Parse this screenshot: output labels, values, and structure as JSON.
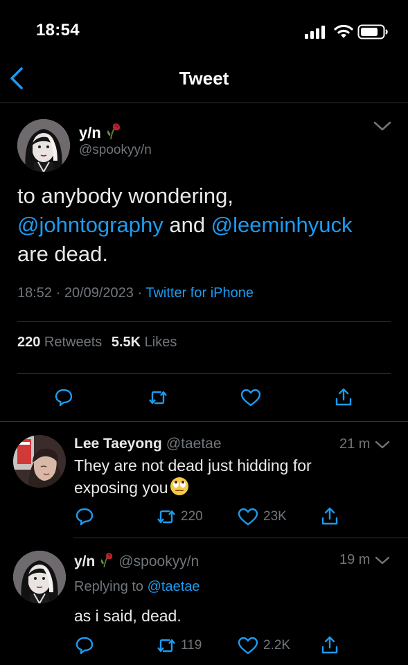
{
  "status_bar": {
    "time": "18:54"
  },
  "nav": {
    "title": "Tweet"
  },
  "tweet": {
    "display_name": "y/n",
    "handle": "@spookyy/n",
    "text_line1": "to anybody wondering,",
    "mention1": "@johntography",
    "and_word": " and ",
    "mention2": "@leeminhyuck",
    "text_line3": "are dead.",
    "timestamp": "18:52 · 20/09/2023 · ",
    "source": "Twitter for iPhone",
    "retweets_count": "220",
    "retweets_label": " Retweets",
    "likes_count": "5.5K",
    "likes_label": " Likes"
  },
  "replies": [
    {
      "display_name": "Lee Taeyong",
      "handle": "@taetae",
      "time": "21 m",
      "text_line1": "They are not dead just hidding for",
      "text_line2": "exposing you",
      "retweets": "220",
      "likes": "23K"
    },
    {
      "display_name": "y/n",
      "handle": "@spookyy/n",
      "time": "19 m",
      "replying_label": "Replying to ",
      "replying_to": "@taetae",
      "text": "as i said, dead.",
      "retweets": "119",
      "likes": "2.2K"
    }
  ],
  "icons": {
    "back": "chevron-left-icon",
    "more": "chevron-down-icon",
    "reply": "comment-icon",
    "retweet": "retweet-icon",
    "like": "heart-icon",
    "share": "share-icon"
  },
  "colors": {
    "accent": "#1d9bf0",
    "secondary_text": "#71767b",
    "divider": "#2f3336"
  }
}
